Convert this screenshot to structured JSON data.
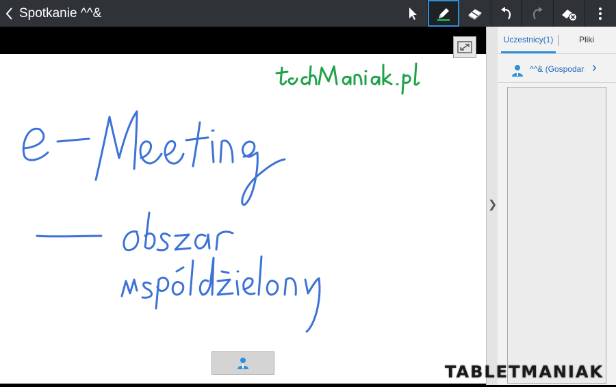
{
  "header": {
    "title": "Spotkanie ^^&",
    "back_icon": "chevron-left-icon",
    "tools": [
      {
        "id": "select",
        "icon": "cursor-arrow-icon",
        "active": false
      },
      {
        "id": "pen",
        "icon": "pen-icon",
        "active": true,
        "pen_color": "#1fa24a"
      },
      {
        "id": "eraser",
        "icon": "eraser-icon",
        "active": false
      },
      {
        "id": "undo",
        "icon": "undo-icon",
        "active": false
      },
      {
        "id": "redo",
        "icon": "redo-icon",
        "active": false,
        "disabled": true
      },
      {
        "id": "clear",
        "icon": "clear-page-icon",
        "active": false
      },
      {
        "id": "more",
        "icon": "more-vertical-icon",
        "active": false
      }
    ]
  },
  "board": {
    "strokes": [
      {
        "text": "techManiak.pl",
        "color": "#1fa24a"
      },
      {
        "text": "e-Meeting",
        "color": "#3d72d6"
      },
      {
        "text": "— obszar",
        "color": "#3d72d6"
      },
      {
        "text": "współdzielony",
        "color": "#3d72d6"
      }
    ],
    "expand_icon": "expand-icon",
    "user_tab_icon": "person-icon"
  },
  "panel": {
    "tabs": [
      {
        "label": "Uczestnicy(1)",
        "active": true
      },
      {
        "label": "Pliki",
        "active": false
      }
    ],
    "participants": [
      {
        "name": "^^& (Gospodarz)",
        "icon": "person-icon"
      }
    ]
  },
  "watermark": {
    "text": "TABLETMANIAK"
  },
  "colors": {
    "accent": "#2f8fd8",
    "topbar": "#2f3338",
    "ink_blue": "#3d72d6",
    "ink_green": "#1fa24a"
  }
}
